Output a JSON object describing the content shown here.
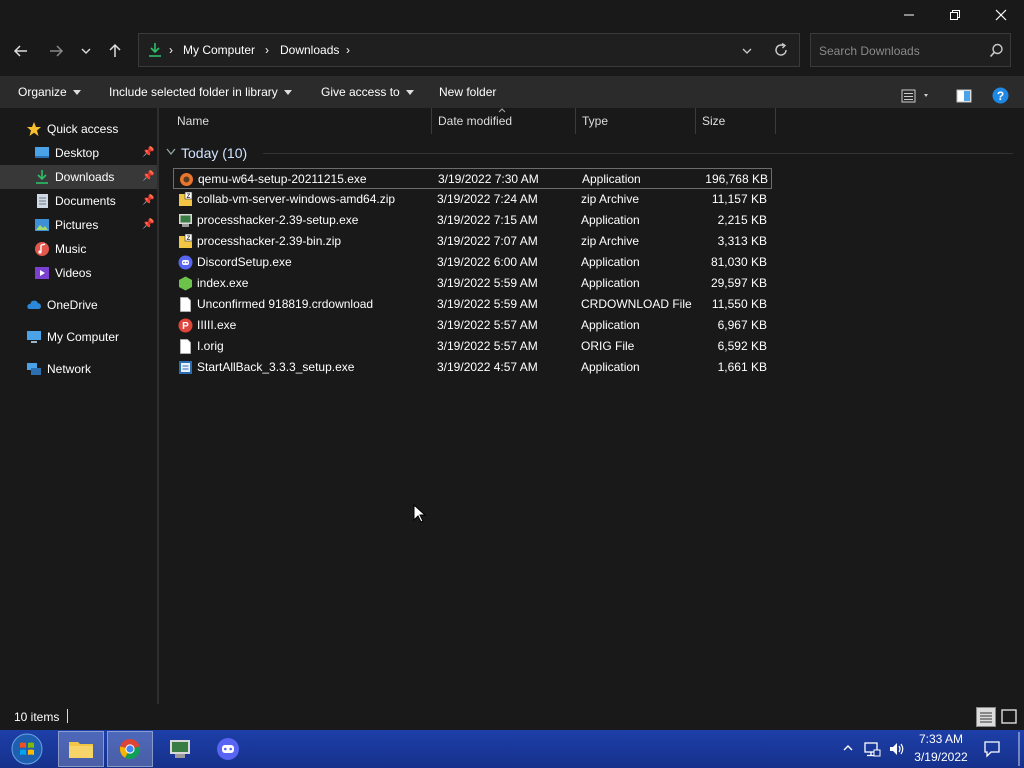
{
  "window": {
    "min_icon": "minimize-icon",
    "max_icon": "restore-icon",
    "close_icon": "close-icon"
  },
  "address": {
    "crumbs": [
      "My Computer",
      "Downloads"
    ],
    "search_placeholder": "Search Downloads"
  },
  "toolbar": {
    "organize": "Organize",
    "include_library": "Include selected folder in library",
    "give_access": "Give access to",
    "new_folder": "New folder"
  },
  "nav": {
    "quick_access": "Quick access",
    "desktop": "Desktop",
    "downloads": "Downloads",
    "documents": "Documents",
    "pictures": "Pictures",
    "music": "Music",
    "videos": "Videos",
    "onedrive": "OneDrive",
    "my_computer": "My Computer",
    "network": "Network"
  },
  "columns": {
    "name": "Name",
    "date": "Date modified",
    "type": "Type",
    "size": "Size"
  },
  "group": {
    "label": "Today (10)"
  },
  "files": [
    {
      "name": "qemu-w64-setup-20211215.exe",
      "date": "3/19/2022 7:30 AM",
      "type": "Application",
      "size": "196,768 KB",
      "icon": "qemu-icon"
    },
    {
      "name": "collab-vm-server-windows-amd64.zip",
      "date": "3/19/2022 7:24 AM",
      "type": "zip Archive",
      "size": "11,157 KB",
      "icon": "zip-icon"
    },
    {
      "name": "processhacker-2.39-setup.exe",
      "date": "3/19/2022 7:15 AM",
      "type": "Application",
      "size": "2,215 KB",
      "icon": "installer-icon"
    },
    {
      "name": "processhacker-2.39-bin.zip",
      "date": "3/19/2022 7:07 AM",
      "type": "zip Archive",
      "size": "3,313 KB",
      "icon": "zip-icon"
    },
    {
      "name": "DiscordSetup.exe",
      "date": "3/19/2022 6:00 AM",
      "type": "Application",
      "size": "81,030 KB",
      "icon": "discord-icon"
    },
    {
      "name": "index.exe",
      "date": "3/19/2022 5:59 AM",
      "type": "Application",
      "size": "29,597 KB",
      "icon": "nodejs-icon"
    },
    {
      "name": "Unconfirmed 918819.crdownload",
      "date": "3/19/2022 5:59 AM",
      "type": "CRDOWNLOAD File",
      "size": "11,550 KB",
      "icon": "blank-file-icon"
    },
    {
      "name": "IIIII.exe",
      "date": "3/19/2022 5:57 AM",
      "type": "Application",
      "size": "6,967 KB",
      "icon": "app-p-icon"
    },
    {
      "name": "I.orig",
      "date": "3/19/2022 5:57 AM",
      "type": "ORIG File",
      "size": "6,592 KB",
      "icon": "blank-file-icon"
    },
    {
      "name": "StartAllBack_3.3.3_setup.exe",
      "date": "3/19/2022 4:57 AM",
      "type": "Application",
      "size": "1,661 KB",
      "icon": "installer-icon"
    }
  ],
  "status": {
    "count": "10 items"
  },
  "clock": {
    "time": "7:33 AM",
    "date": "3/19/2022"
  },
  "colors": {
    "accent_blue": "#2b88d8",
    "folder_yellow": "#f3c544",
    "discord": "#5865f2",
    "taskbar": "#1d3fa8"
  }
}
